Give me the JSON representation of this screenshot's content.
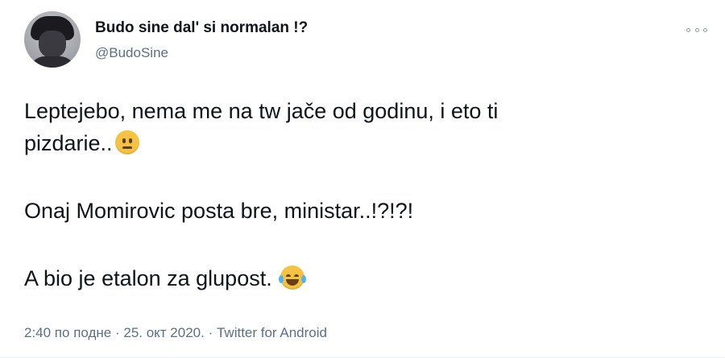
{
  "user": {
    "name": "Budo sine dal' si normalan !?",
    "handle": "@BudoSine"
  },
  "tweet": {
    "paragraphs": [
      {
        "lines": [
          "Leptejebo, nema me na tw jače od godinu, i eto ti",
          "pizdarie.."
        ],
        "emoji": "neutral-face-icon"
      },
      {
        "lines": [
          "Onaj Momirovic posta bre, ministar..!?!?!"
        ]
      },
      {
        "lines": [
          "A bio je etalon za glupost."
        ],
        "emoji": "tears-of-joy-icon"
      }
    ]
  },
  "meta": {
    "time": "2:40 по подне",
    "separator": " · ",
    "date": "25. окт 2020.",
    "source": "Twitter for Android"
  },
  "colors": {
    "text": "#0f1419",
    "secondary": "#5b7083",
    "background": "#ffffff"
  }
}
